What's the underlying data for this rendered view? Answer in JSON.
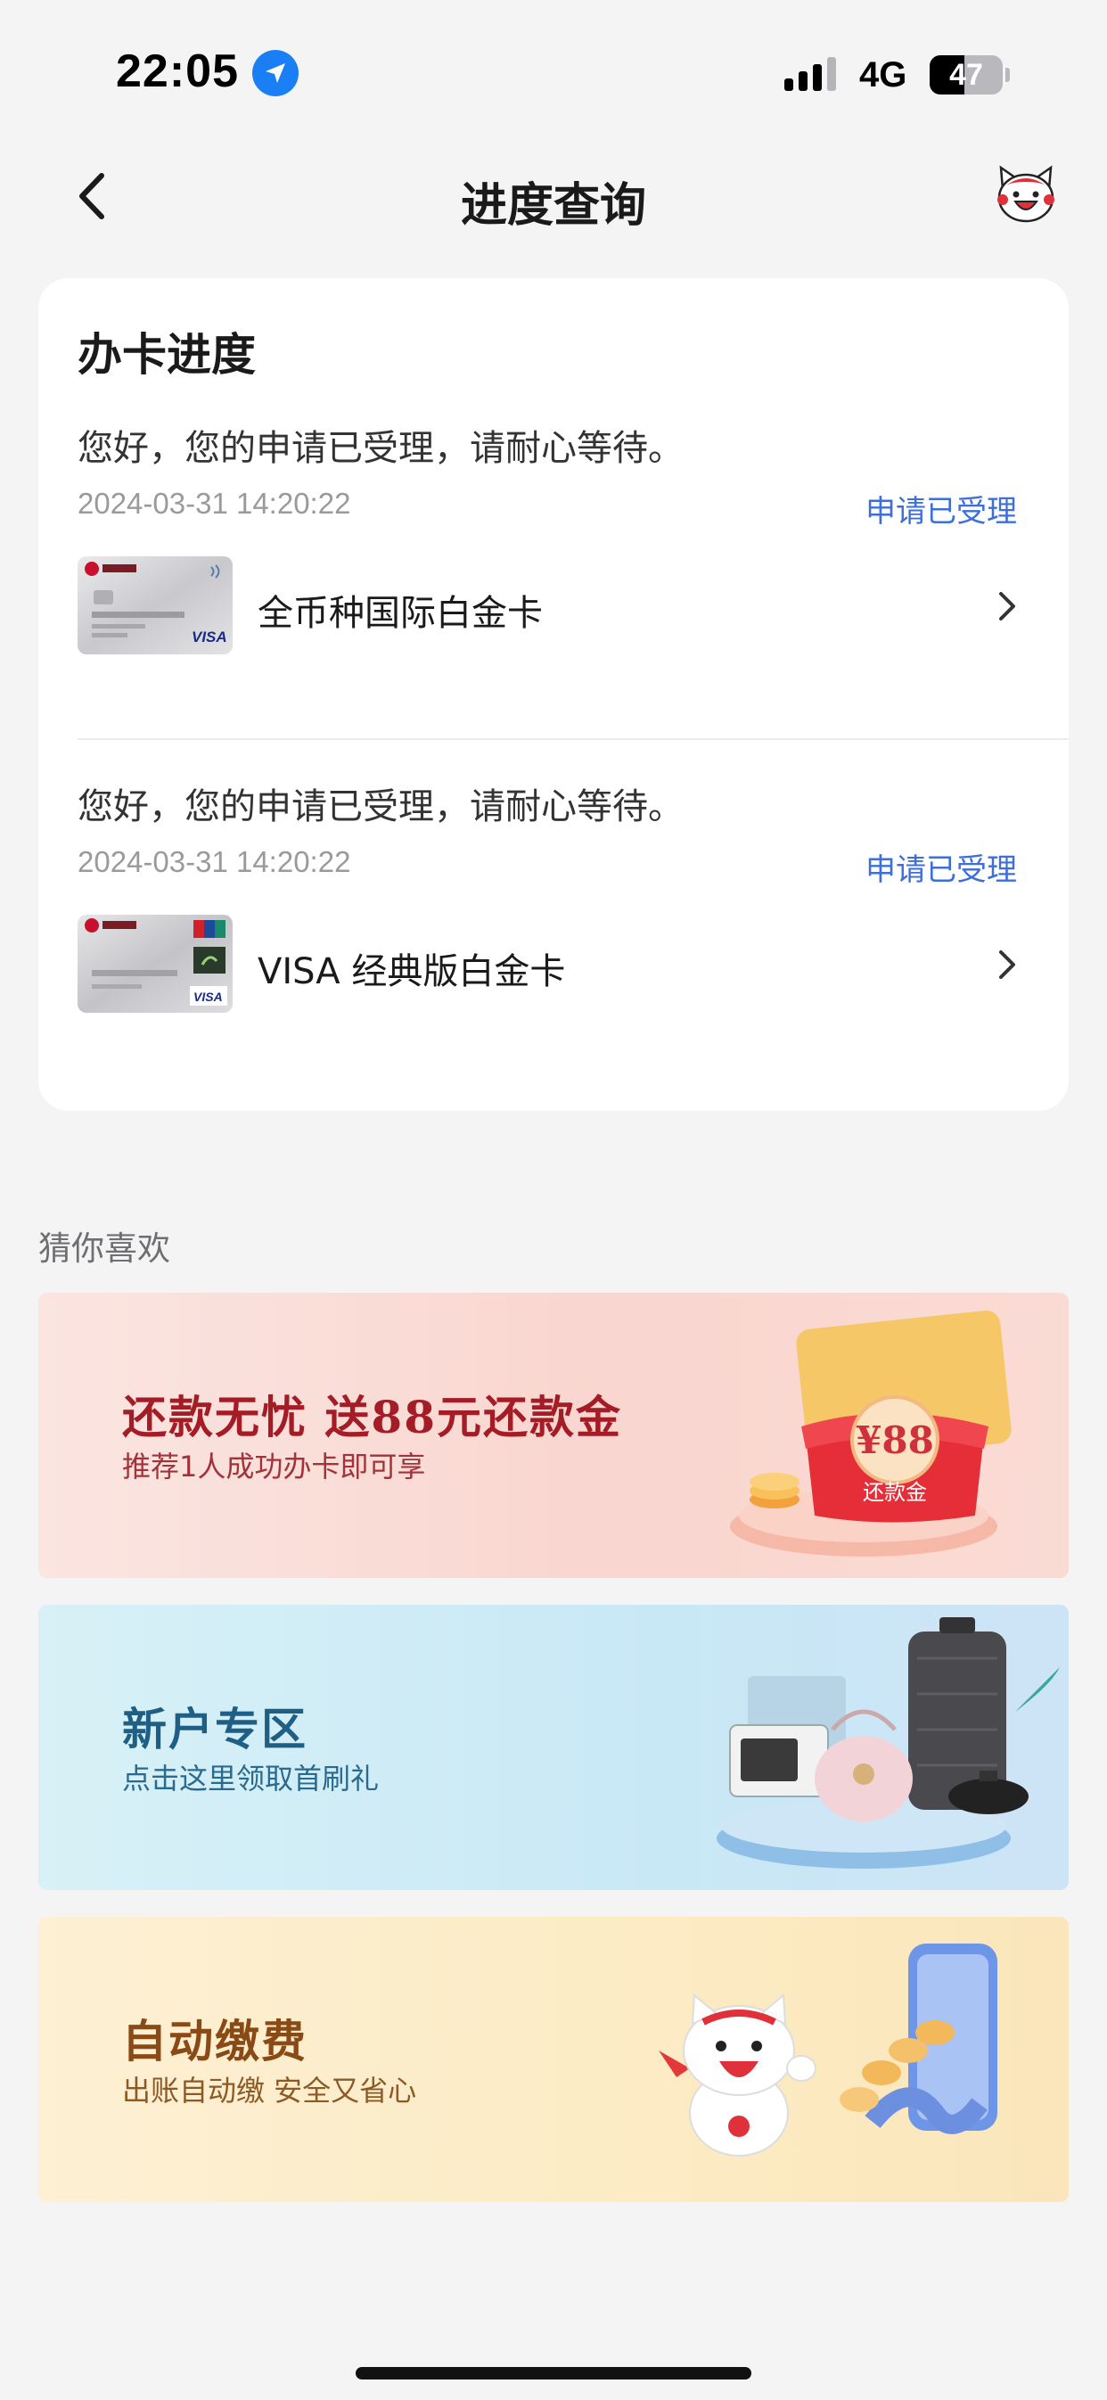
{
  "status_bar": {
    "time": "22:05",
    "network": "4G",
    "battery": "47",
    "battery_level": 0.47,
    "location_icon": "location-arrow-icon",
    "signal_icon": "cellular-signal-icon"
  },
  "nav": {
    "title": "进度查询",
    "back_icon": "chevron-left-icon",
    "assistant_icon": "cat-mascot-icon"
  },
  "progress_card": {
    "title": "办卡进度",
    "entries": [
      {
        "message": "您好，您的申请已受理，请耐心等待。",
        "time": "2024-03-31 14:20:22",
        "status": "申请已受理",
        "card_name": "全币种国际白金卡",
        "card_image": "visa-signature-platinum-card"
      },
      {
        "message": "您好，您的申请已受理，请耐心等待。",
        "time": "2024-03-31 14:20:22",
        "status": "申请已受理",
        "card_name": "VISA 经典版白金卡",
        "card_image": "visa-unionpay-platinum-card"
      }
    ]
  },
  "recommend": {
    "title": "猜你喜欢",
    "banners": [
      {
        "title": "还款无忧 送88元还款金",
        "subtitle": "推荐1人成功办卡即可享",
        "badge_amount": "¥88",
        "badge_label": "还款金",
        "accent": "#a31c26"
      },
      {
        "title": "新户专区",
        "subtitle": "点击这里领取首刷礼",
        "accent": "#1f5f86"
      },
      {
        "title": "自动缴费",
        "subtitle": "出账自动缴 安全又省心",
        "accent": "#8a4a16"
      }
    ]
  },
  "colors": {
    "link": "#3e6fd8",
    "background": "#f4f4f5",
    "card": "#ffffff"
  }
}
